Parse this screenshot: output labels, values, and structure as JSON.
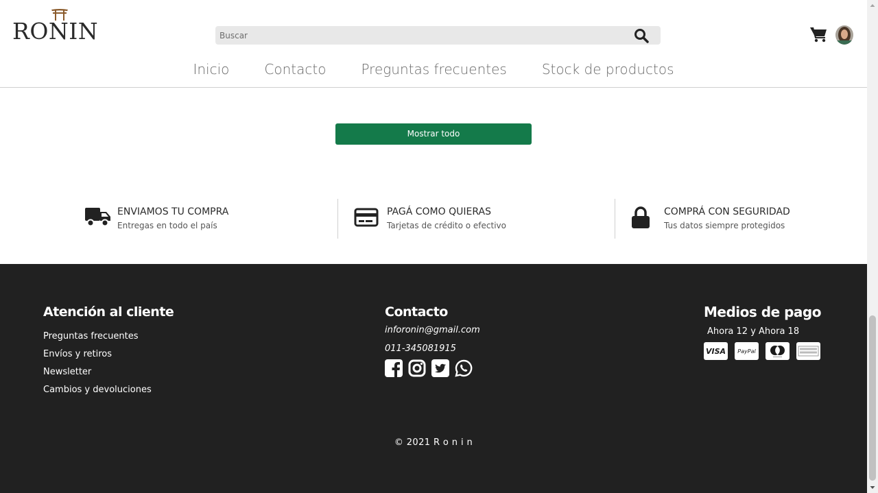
{
  "header": {
    "logo_text": "RONIN",
    "search_placeholder": "Buscar",
    "search_value": "",
    "nav": [
      "Inicio",
      "Contacto",
      "Preguntas frecuentes",
      "Stock de productos"
    ]
  },
  "main": {
    "show_all_label": "Mostrar todo",
    "features": [
      {
        "title": "ENVIAMOS TU COMPRA",
        "subtitle": "Entregas en todo el país",
        "icon": "truck-icon"
      },
      {
        "title": "PAGÁ COMO QUIERAS",
        "subtitle": "Tarjetas de crédito o efectivo",
        "icon": "credit-card-icon"
      },
      {
        "title": "COMPRÁ CON SEGURIDAD",
        "subtitle": "Tus datos siempre protegidos",
        "icon": "lock-icon"
      }
    ]
  },
  "footer": {
    "customer_service": {
      "title": "Atención al cliente",
      "links": [
        "Preguntas frecuentes",
        "Envíos y retiros",
        "Newsletter",
        "Cambios y devoluciones"
      ]
    },
    "contact": {
      "title": "Contacto",
      "email": "inforonin@gmail.com",
      "phone": "011-345081915",
      "socials": [
        "facebook-icon",
        "instagram-icon",
        "twitter-icon",
        "whatsapp-icon"
      ]
    },
    "payment": {
      "title": "Medios de pago",
      "subtitle": "Ahora 12 y Ahora 18",
      "cards": [
        "VISA",
        "PayPal",
        "mastercard-icon",
        "amex-icon"
      ]
    },
    "copyright": "© 2021 R o n i n"
  },
  "colors": {
    "accent_green": "#147a4a",
    "footer_bg": "#212121",
    "search_bg": "#e8e8e8"
  }
}
